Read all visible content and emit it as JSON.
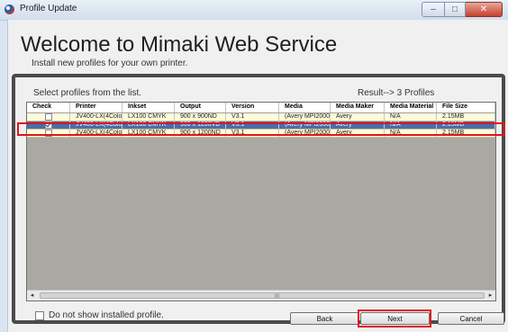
{
  "window": {
    "title": "Profile Update",
    "minimize_glyph": "–",
    "maximize_glyph": "□",
    "close_glyph": "✕"
  },
  "page": {
    "heading": "Welcome to Mimaki Web Service",
    "subheading": "Install new profiles for your own printer."
  },
  "profiles": {
    "select_label": "Select profiles from the list.",
    "result_label": "Result--> 3 Profiles",
    "columns": [
      "Check",
      "Printer",
      "Inkset",
      "Output",
      "Version",
      "Media",
      "Media Maker",
      "Media Material",
      "File Size"
    ],
    "rows": [
      {
        "checked": false,
        "selected": false,
        "cells": [
          "JV400-LX(4Color)",
          "LX100 CMYK",
          "900 x 900ND",
          "V3.1",
          "(Avery MPI2000 ...",
          "Avery",
          "N/A",
          "2.15MB"
        ]
      },
      {
        "checked": true,
        "selected": true,
        "cells": [
          "JV400-LX(4Color)",
          "LX100 CMYK",
          "900 x 1200VD",
          "V3.1",
          "(Avery MPI2000 ...",
          "Avery",
          "N/A",
          "2.15MB"
        ]
      },
      {
        "checked": false,
        "selected": false,
        "cells": [
          "JV400-LX(4Color)",
          "LX100 CMYK",
          "900 x 1200ND",
          "V3.1",
          "(Avery MPI2000 ...",
          "Avery",
          "N/A",
          "2.15MB"
        ]
      }
    ],
    "scroll_left": "◂",
    "scroll_right": "▸",
    "scroll_grip": "III"
  },
  "options": {
    "do_not_show_label": "Do not show installed profile.",
    "do_not_show_checked": false
  },
  "buttons": {
    "back": "Back",
    "next": "Next",
    "cancel": "Cancel"
  },
  "colors": {
    "highlight": "#e0141e",
    "selected_row": "#4a6ea9",
    "row_background": "#fffbd8"
  }
}
